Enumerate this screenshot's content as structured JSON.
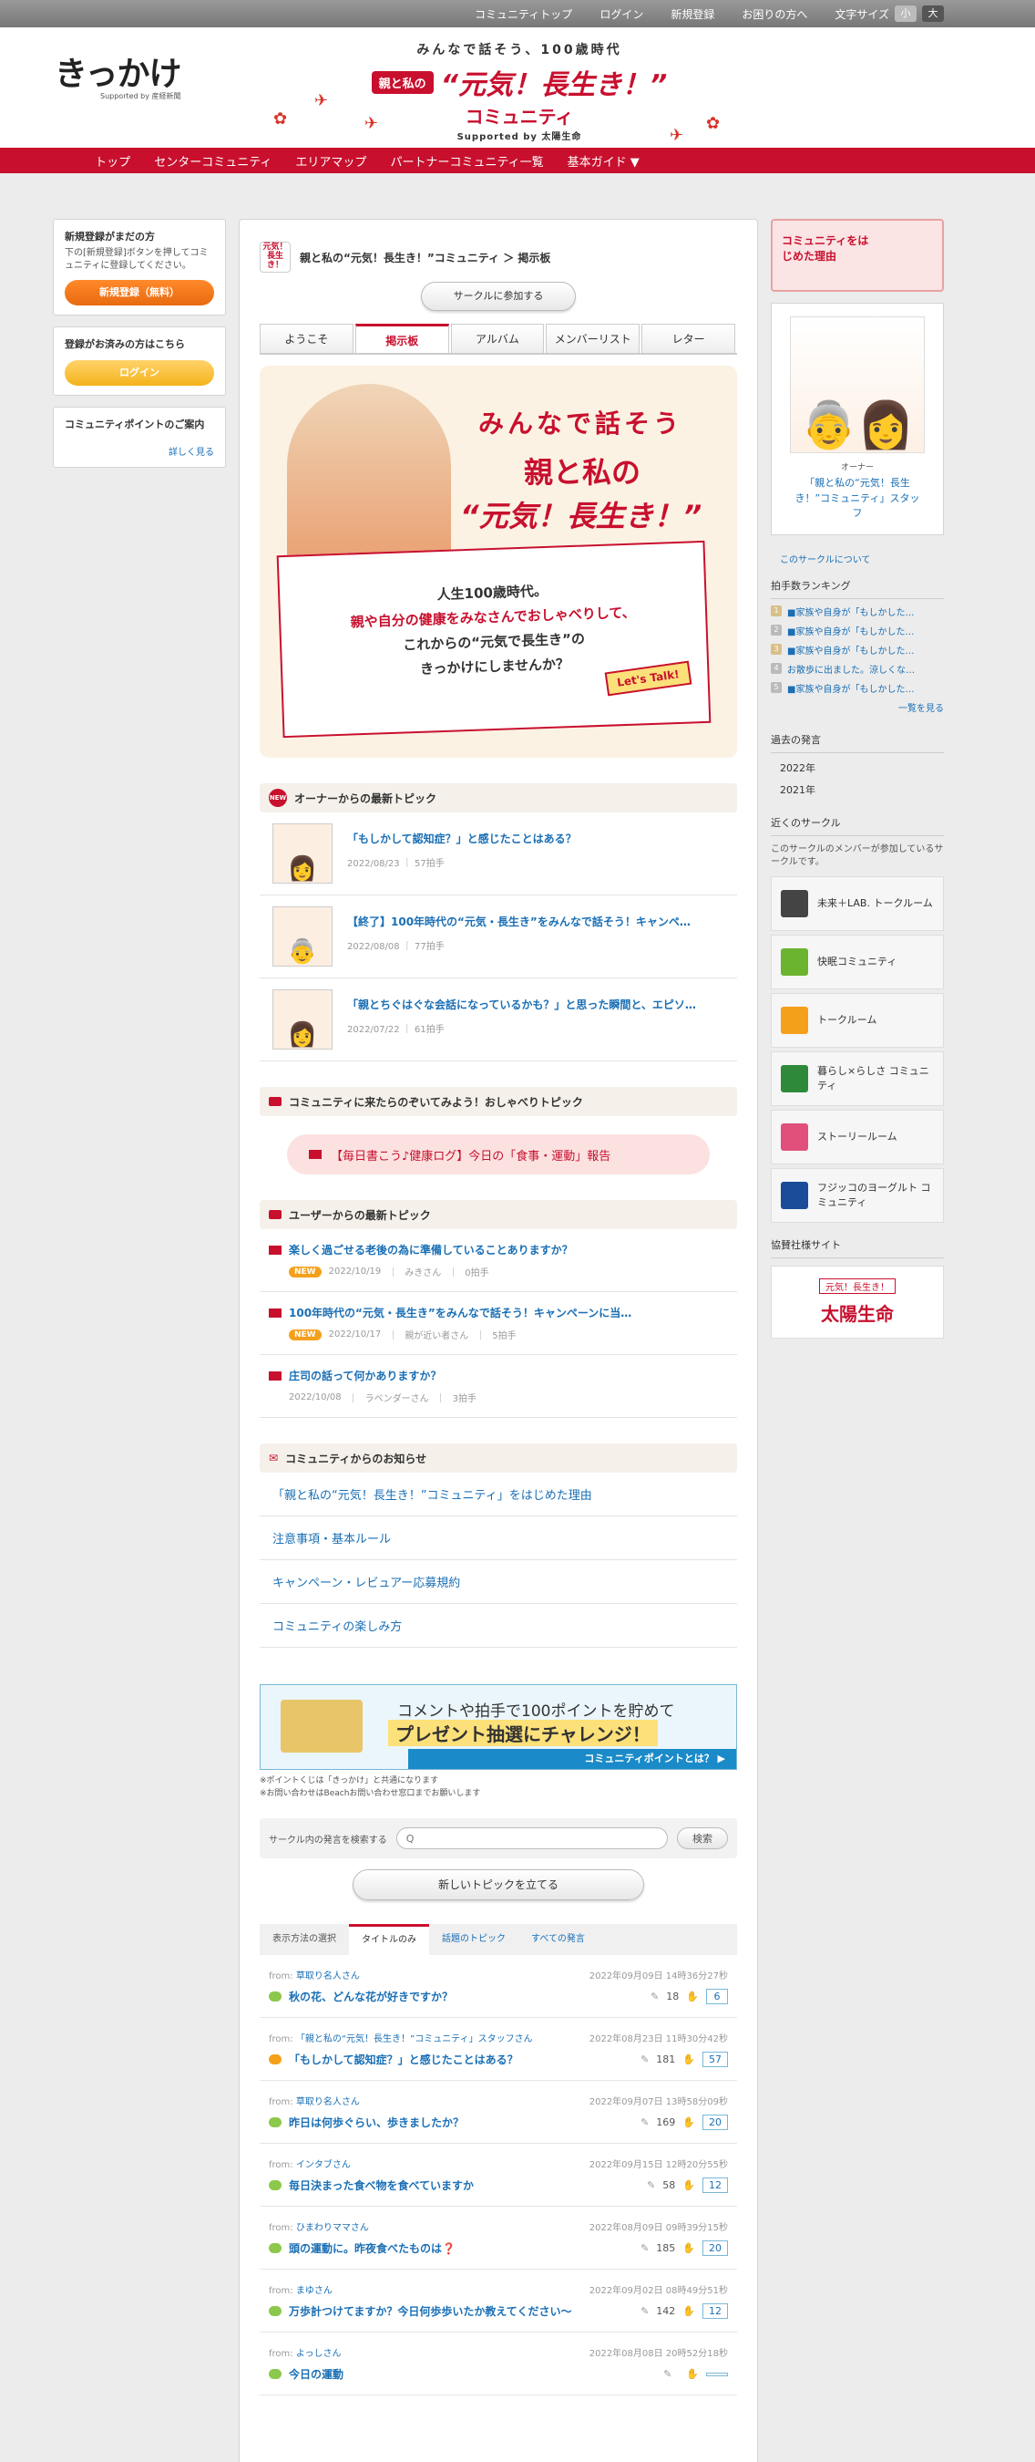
{
  "topbar": {
    "items": [
      "コミュニティトップ",
      "ログイン",
      "新規登録",
      "お困りの方へ"
    ],
    "fontsize_label": "文字サイズ",
    "small": "小",
    "large": "大"
  },
  "logo": {
    "name": "きっかけ",
    "sub": "Supported by 産経新聞"
  },
  "brand": {
    "tagline": "みんなで話そう、100歳時代",
    "pill": "親と私の",
    "title": "“元気！長生き！”",
    "title2": "コミュニティ",
    "sponsor": "Supported by 太陽生命"
  },
  "nav": [
    "トップ",
    "センターコミュニティ",
    "エリアマップ",
    "パートナーコミュニティ一覧",
    "基本ガイド ▼"
  ],
  "left": {
    "reg_title": "新規登録がまだの方",
    "reg_desc": "下の[新規登録]ボタンを押してコミュニティに登録してください。",
    "reg_btn": "新規登録（無料）",
    "login_title": "登録がお済みの方はこちら",
    "login_btn": "ログイン",
    "points_title": "コミュニティポイントのご案内",
    "points_more": "詳しく見る"
  },
  "crumb": {
    "icon": "元気！長生き！",
    "text": "親と私の“元気！長生き！”コミュニティ ＞ 掲示板"
  },
  "join_btn": "サークルに参加する",
  "tabs": [
    "ようこそ",
    "掲示板",
    "アルバム",
    "メンバーリスト",
    "レター"
  ],
  "hero": {
    "h1": "みんなで話そう",
    "h2": "親と私の",
    "h3": "“元気！長生き！”",
    "l1": "人生100歳時代。",
    "l2": "親や自分の健康をみなさんでおしゃべりして、",
    "l3": "これからの“元気で長生き”の",
    "l4": "きっかけにしませんか？",
    "talk": "Let's Talk!"
  },
  "owner_sec": {
    "badge": "NEW",
    "title": "オーナーからの最新トピック",
    "items": [
      {
        "title": "「もしかして認知症？」と感じたことはある？",
        "date": "2022/08/23",
        "claps": "57拍手"
      },
      {
        "title": "【終了】100年時代の“元気・長生き”をみんなで話そう！キャンペ…",
        "date": "2022/08/08",
        "claps": "77拍手"
      },
      {
        "title": "「親とちぐはぐな会話になっているかも？」と思った瞬間と、エピソ…",
        "date": "2022/07/22",
        "claps": "61拍手"
      }
    ]
  },
  "chat_sec": {
    "title": "コミュニティに来たらのぞいてみよう！おしゃべりトピック",
    "btn": "【毎日書こう♪健康ログ】今日の「食事・運動」報告"
  },
  "user_sec": {
    "title": "ユーザーからの最新トピック",
    "items": [
      {
        "title": "楽しく過ごせる老後の為に準備していることありますか？",
        "badge": "NEW",
        "date": "2022/10/19",
        "user": "みきさん",
        "claps": "0拍手"
      },
      {
        "title": "100年時代の“元気・長生き”をみんなで話そう！キャンペーンに当…",
        "badge": "NEW",
        "date": "2022/10/17",
        "user": "親が近い者さん",
        "claps": "5拍手"
      },
      {
        "title": "庄司の話って何かありますか？",
        "badge": "",
        "date": "2022/10/08",
        "user": "ラベンダーさん",
        "claps": "3拍手"
      }
    ]
  },
  "notice_sec": {
    "title": "コミュニティからのお知らせ",
    "items": [
      "「親と私の“元気！長生き！”コミュニティ」をはじめた理由",
      "注意事項・基本ルール",
      "キャンペーン・レビュアー応募規約",
      "コミュニティの楽しみ方"
    ]
  },
  "banner": {
    "l1": "コメントや拍手で100ポイントを貯めて",
    "l2": "プレゼント抽選にチャレンジ！",
    "l3": "コミュニティポイントとは？ ▶"
  },
  "notes": [
    "※ポイントくじは「きっかけ」と共通になります",
    "※お問い合わせはBeachお問い合わせ窓口までお願いします"
  ],
  "search": {
    "label": "サークル内の発言を検索する",
    "placeholder": "Q",
    "btn": "検索"
  },
  "new_topic_btn": "新しいトピックを立てる",
  "dtabs": {
    "label": "表示方法の選択",
    "items": [
      "タイトルのみ",
      "話題のトピック",
      "すべての発言"
    ]
  },
  "posts": [
    {
      "from": "草取り名人さん",
      "date": "2022年09月09日 14時36分27秒",
      "title": "秋の花、どんな花が好きですか？",
      "comments": "18",
      "claps": "6",
      "or": false
    },
    {
      "from": "「親と私の“元気！長生き！”コミュニティ」スタッフさん",
      "date": "2022年08月23日 11時30分42秒",
      "title": "「もしかして認知症？」と感じたことはある？",
      "comments": "181",
      "claps": "57",
      "or": true
    },
    {
      "from": "草取り名人さん",
      "date": "2022年09月07日 13時58分09秒",
      "title": "昨日は何歩ぐらい、歩きましたか？",
      "comments": "169",
      "claps": "20",
      "or": false
    },
    {
      "from": "インタブさん",
      "date": "2022年09月15日 12時20分55秒",
      "title": "毎日決まった食べ物を食べていますか",
      "comments": "58",
      "claps": "12",
      "or": false
    },
    {
      "from": "ひまわりママさん",
      "date": "2022年08月09日 09時39分15秒",
      "title": "頭の運動に。昨夜食べたものは❓",
      "comments": "185",
      "claps": "20",
      "or": false
    },
    {
      "from": "まゆさん",
      "date": "2022年09月02日 08時49分51秒",
      "title": "万歩計つけてますか？今日何歩歩いたか教えてください〜",
      "comments": "142",
      "claps": "12",
      "or": false
    },
    {
      "from": "よっしさん",
      "date": "2022年08月08日 20時52分18秒",
      "title": "今日の運動",
      "comments": "",
      "claps": "",
      "or": false
    }
  ],
  "right": {
    "banner": "コミュニティをはじめた理由",
    "owner_label": "オーナー",
    "owner_name": "「親と私の“元気！長生き！”コミュニティ」スタッフ",
    "about": "このサークルについて",
    "rank_title": "拍手数ランキング",
    "ranks": [
      "■家族や自身が「もしかした…",
      "■家族や自身が「もしかした…",
      "■家族や自身が「もしかした…",
      "お散歩に出ました。涼しくな…",
      "■家族や自身が「もしかした…"
    ],
    "rank_more": "一覧を見る",
    "past_title": "過去の発言",
    "years": [
      "2022年",
      "2021年"
    ],
    "near_title": "近くのサークル",
    "near_desc": "このサークルのメンバーが参加しているサークルです。",
    "circles": [
      {
        "name": "未来＋LAB. トークルーム",
        "color": "#444"
      },
      {
        "name": "快眠コミュニティ",
        "color": "#6ab42f"
      },
      {
        "name": "トークルーム",
        "color": "#f5a01a"
      },
      {
        "name": "暮らし×らしさ コミュニティ",
        "color": "#2e8a3a"
      },
      {
        "name": "ストーリールーム",
        "color": "#e0507a"
      },
      {
        "name": "フジッコのヨーグルト コミュニティ",
        "color": "#1a4c9a"
      }
    ],
    "sponsor_title": "協賛社様サイト",
    "sponsor_tag": "元気！長生き！",
    "sponsor_name": "太陽生命"
  }
}
